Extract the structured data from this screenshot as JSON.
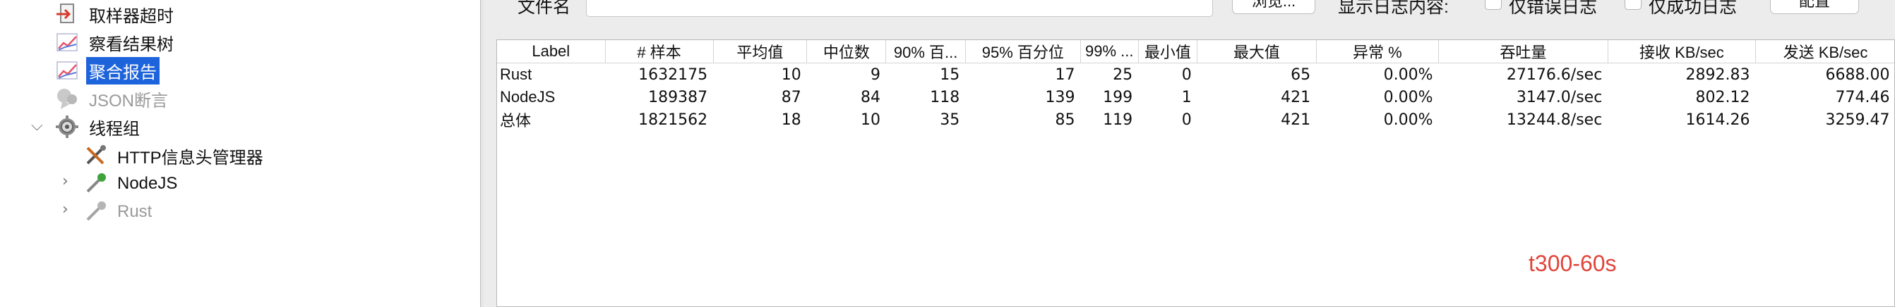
{
  "tree": {
    "items": [
      {
        "label": "取样器超时",
        "icon": "timer-icon"
      },
      {
        "label": "察看结果树",
        "icon": "chart-listener-icon"
      },
      {
        "label": "聚合报告",
        "icon": "chart-listener-icon"
      },
      {
        "label": "JSON断言",
        "icon": "assertion-icon"
      },
      {
        "label": "线程组",
        "icon": "gear-icon"
      },
      {
        "label": "HTTP信息头管理器",
        "icon": "tools-icon"
      },
      {
        "label": "NodeJS",
        "icon": "pipette-icon"
      },
      {
        "label": "Rust",
        "icon": "pipette-icon"
      }
    ]
  },
  "toolbar": {
    "filename_label": "文件名",
    "browse_label": "浏览...",
    "log_label": "显示日志内容:",
    "errors_only_label": "仅错误日志",
    "success_only_label": "仅成功日志",
    "config_label": "配置"
  },
  "table": {
    "headers": [
      "Label",
      "# 样本",
      "平均值",
      "中位数",
      "90% 百...",
      "95% 百分位",
      "99% ...",
      "最小值",
      "最大值",
      "异常 %",
      "吞吐量",
      "接收 KB/sec",
      "发送 KB/sec"
    ],
    "rows": [
      [
        "Rust",
        "1632175",
        "10",
        "9",
        "15",
        "17",
        "25",
        "0",
        "65",
        "0.00%",
        "27176.6/sec",
        "2892.83",
        "6688.00"
      ],
      [
        "NodeJS",
        "189387",
        "87",
        "84",
        "118",
        "139",
        "199",
        "1",
        "421",
        "0.00%",
        "3147.0/sec",
        "802.12",
        "774.46"
      ],
      [
        "总体",
        "1821562",
        "18",
        "10",
        "35",
        "85",
        "119",
        "0",
        "421",
        "0.00%",
        "13244.8/sec",
        "1614.26",
        "3259.47"
      ]
    ]
  },
  "watermark": "t300-60s",
  "colors": {
    "selection": "#1d63db",
    "watermark": "#e0443a"
  }
}
